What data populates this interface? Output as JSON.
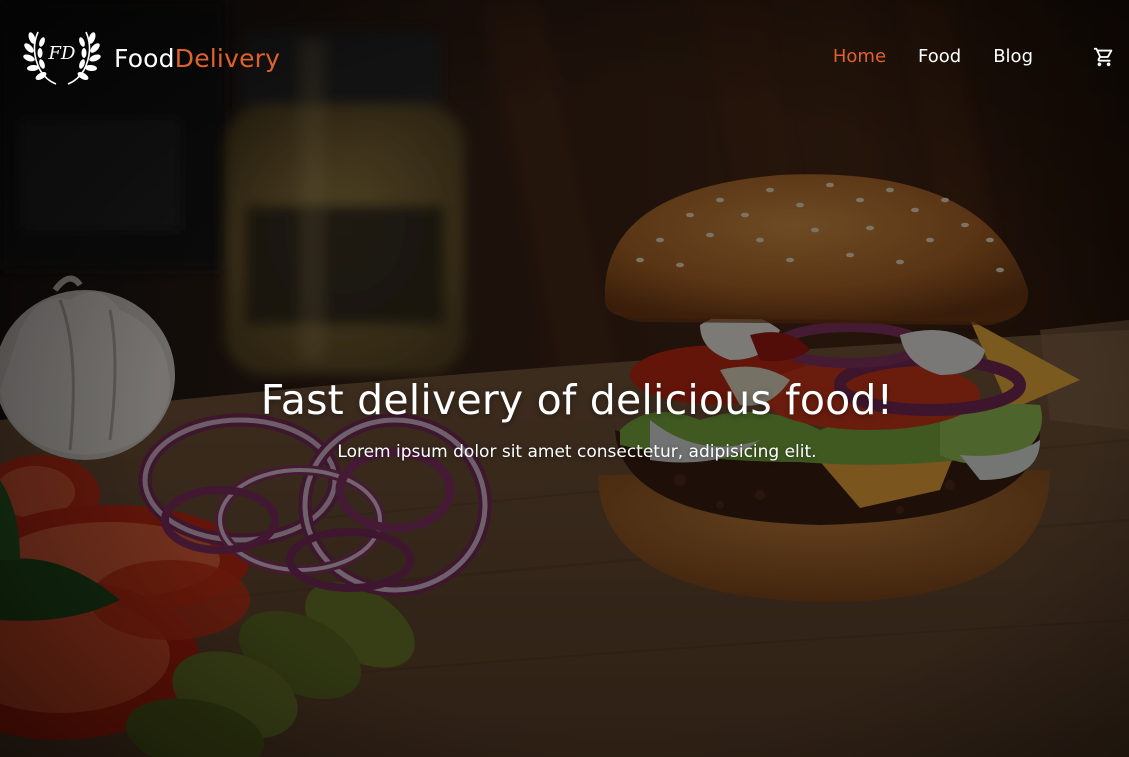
{
  "brand": {
    "name_part1": "Food",
    "name_part2": "Delivery",
    "emblem_initials": "FD",
    "accent_color": "#e1612b"
  },
  "nav": {
    "items": [
      {
        "label": "Home",
        "active": true
      },
      {
        "label": "Food",
        "active": false
      },
      {
        "label": "Blog",
        "active": false
      }
    ],
    "cart_icon": "shopping-cart-icon"
  },
  "hero": {
    "title": "Fast delivery of delicious food!",
    "subtitle": "Lorem ipsum dolor sit amet consectetur, adipisicing elit.",
    "background": "burger-photo"
  }
}
